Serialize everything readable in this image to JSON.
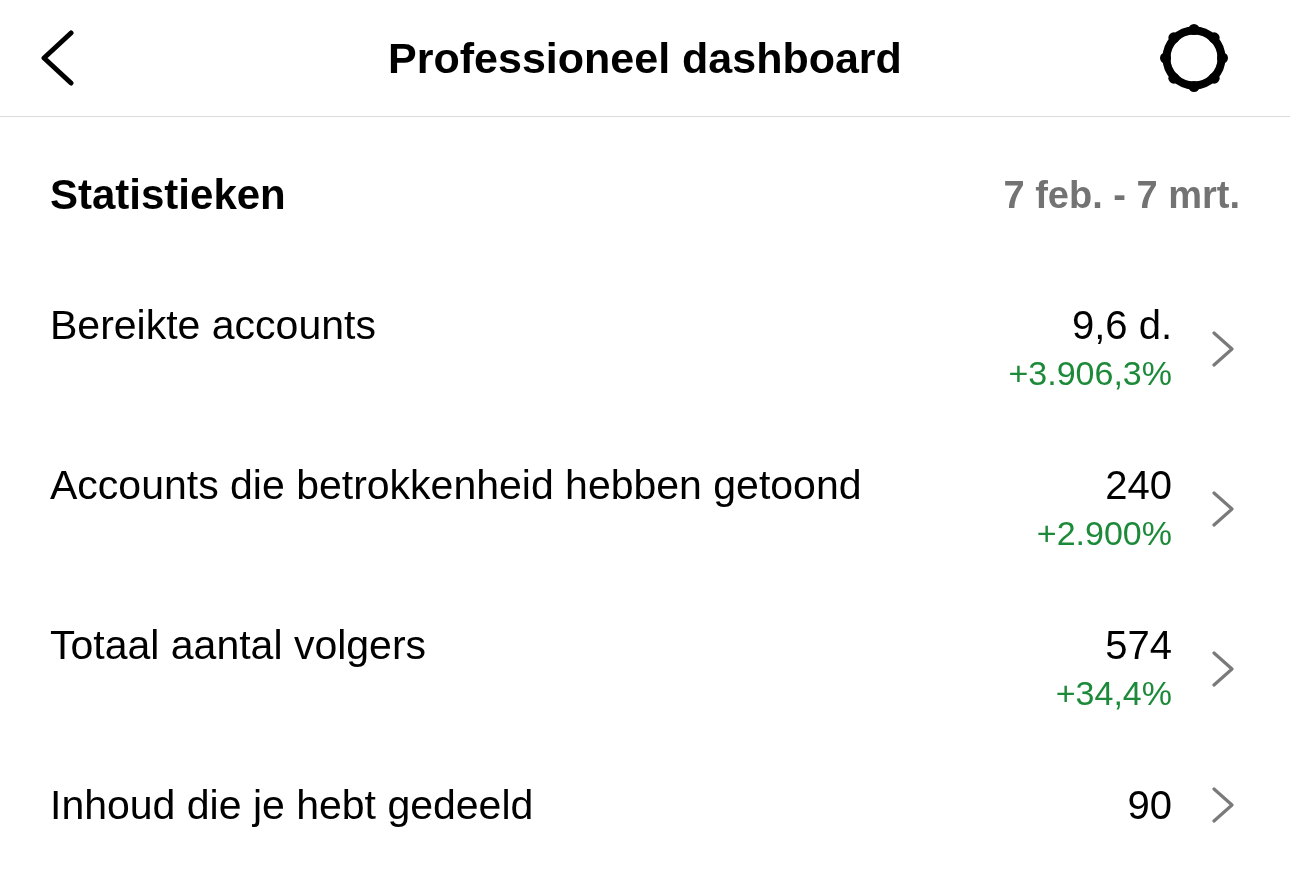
{
  "header": {
    "title": "Professioneel dashboard"
  },
  "section": {
    "title": "Statistieken",
    "date_range": "7 feb. - 7 mrt."
  },
  "metrics": [
    {
      "label": "Bereikte accounts",
      "value": "9,6 d.",
      "change": "+3.906,3%"
    },
    {
      "label": "Accounts die betrokkenheid hebben getoond",
      "value": "240",
      "change": "+2.900%"
    },
    {
      "label": "Totaal aantal volgers",
      "value": "574",
      "change": "+34,4%"
    },
    {
      "label": "Inhoud die je hebt gedeeld",
      "value": "90"
    }
  ]
}
